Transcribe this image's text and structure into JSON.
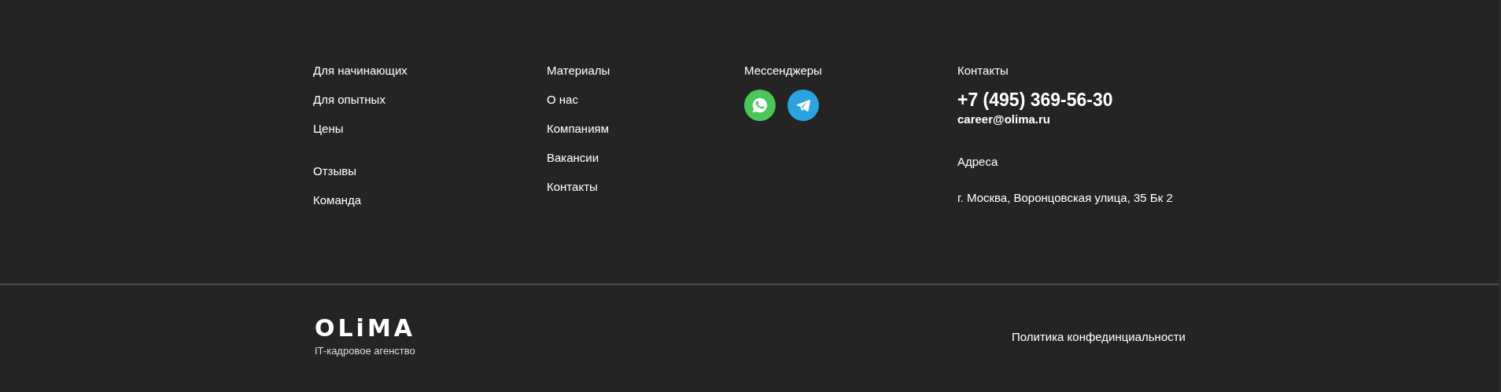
{
  "columns": [
    {
      "groups": [
        [
          "Для начинающих",
          "Для опытных",
          "Цены"
        ],
        [
          "Отзывы",
          "Команда"
        ]
      ]
    },
    {
      "groups": [
        [
          "Материалы",
          "О нас",
          "Компаниям",
          "Вакансии",
          "Контакты"
        ]
      ]
    }
  ],
  "messengers": {
    "title": "Мессенджеры",
    "items": [
      {
        "kind": "whatsapp",
        "color": "#4ac65a"
      },
      {
        "kind": "telegram",
        "color": "#2aa3e0"
      }
    ]
  },
  "contacts": {
    "title": "Контакты",
    "phone": "+7 (495) 369-56-30",
    "email": "career@olima.ru",
    "address_title": "Адреса",
    "address": "г. Москва, Воронцовская улица, 35 Бк 2"
  },
  "bottom": {
    "logo": "OLiMA",
    "tagline": "IT-кадровое агенство",
    "policy": "Политика конфединциальности"
  }
}
